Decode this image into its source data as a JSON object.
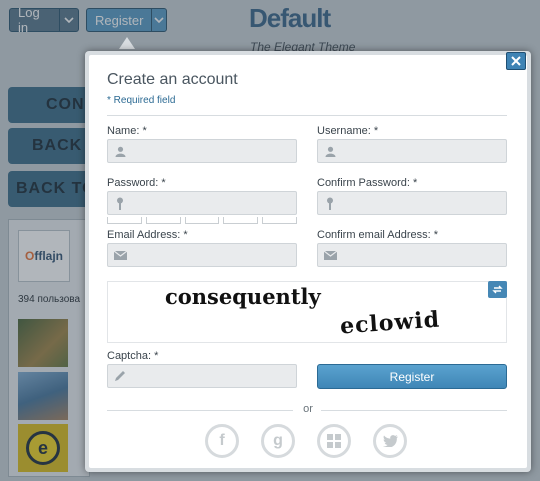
{
  "topbar": {
    "login_label": "Log in",
    "register_label": "Register"
  },
  "site": {
    "title": "Default",
    "tagline": "The Elegant Theme"
  },
  "sidebar": {
    "buttons": [
      "CON",
      "BACK",
      "BACK TO"
    ]
  },
  "widget": {
    "logo_text_o": "O",
    "logo_text_rest": "fflajn",
    "member_count": "394 пользова"
  },
  "modal": {
    "title": "Create an account",
    "required_note": "* Required field",
    "fields": {
      "name_label": "Name: *",
      "username_label": "Username: *",
      "password_label": "Password: *",
      "confirm_password_label": "Confirm Password: *",
      "email_label": "Email Address: *",
      "confirm_email_label": "Confirm email Address: *",
      "captcha_label": "Captcha: *"
    },
    "captcha": {
      "word1": "consequently",
      "word2": "eclowid"
    },
    "submit_label": "Register",
    "or_label": "or",
    "social": [
      "facebook",
      "google-plus",
      "windows",
      "twitter"
    ]
  }
}
